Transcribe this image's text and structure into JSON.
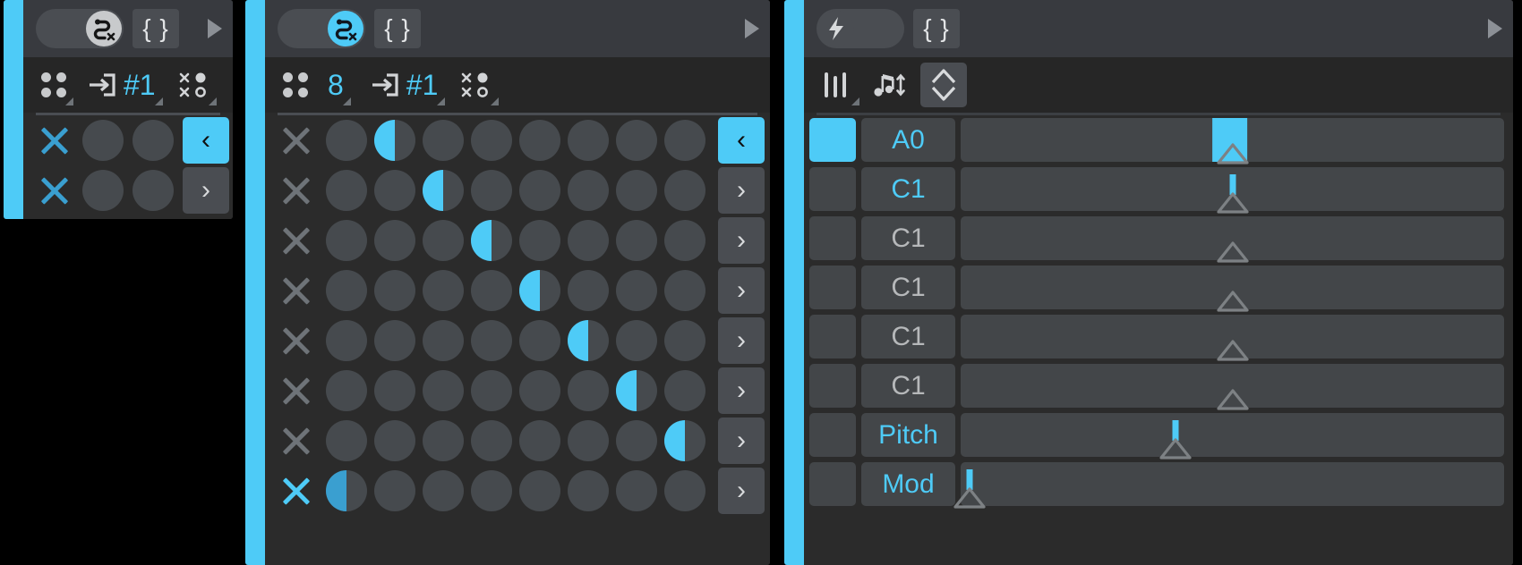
{
  "theme": {
    "accent": "#4ecbf7",
    "accent_dim": "#3a9fd0",
    "panel_bg": "#2b2b2b",
    "title_bg": "#383a3f",
    "toolbar_bg": "#262626",
    "control_bg": "#4a4d52",
    "lane_bg": "#434649",
    "text_light": "#e2e4e6",
    "text_muted": "#b6b8ba",
    "page_bg": "#000000"
  },
  "panel_modulator_small": {
    "name": "modulator-panel",
    "title": {
      "toggle_icon": "routing-disabled-icon",
      "toggle_state": "off",
      "expression_label": "{ }",
      "expand_icon": "play-triangle-icon"
    },
    "toolbar": [
      {
        "icon": "four-dots-icon",
        "label": "",
        "has_corner": true
      },
      {
        "icon": "input-arrow-icon",
        "label": "#1",
        "has_corner": true
      },
      {
        "icon": "scatter-dots-icon",
        "label": "",
        "has_corner": true
      }
    ],
    "rows": [
      {
        "clear_icon": "x-icon",
        "clear_color": "accent_dim",
        "dots": [
          0,
          0
        ],
        "nav_label": "‹",
        "nav_active": true
      },
      {
        "clear_icon": "x-icon",
        "clear_color": "accent_dim",
        "dots": [
          0,
          0
        ],
        "nav_label": "›",
        "nav_active": false
      }
    ]
  },
  "panel_sequencer": {
    "name": "step-sequencer-panel",
    "title": {
      "toggle_icon": "routing-disabled-icon",
      "toggle_state": "on",
      "expression_label": "{ }",
      "expand_icon": "play-triangle-icon"
    },
    "toolbar": [
      {
        "icon": "four-dots-icon",
        "label": "",
        "has_corner": false
      },
      {
        "icon": "",
        "label": "8",
        "has_corner": true
      },
      {
        "icon": "input-arrow-icon",
        "label": "#1",
        "has_corner": true
      },
      {
        "icon": "scatter-dots-icon",
        "label": "",
        "has_corner": true
      }
    ],
    "step_count": 8,
    "row_count": 8,
    "rows": [
      {
        "clear_icon": "x-icon",
        "clear_active": false,
        "active_step": 2,
        "step_dim": false,
        "nav_label": "‹",
        "nav_active": true
      },
      {
        "clear_icon": "x-icon",
        "clear_active": false,
        "active_step": 3,
        "step_dim": false,
        "nav_label": "›",
        "nav_active": false
      },
      {
        "clear_icon": "x-icon",
        "clear_active": false,
        "active_step": 4,
        "step_dim": false,
        "nav_label": "›",
        "nav_active": false
      },
      {
        "clear_icon": "x-icon",
        "clear_active": false,
        "active_step": 5,
        "step_dim": false,
        "nav_label": "›",
        "nav_active": false
      },
      {
        "clear_icon": "x-icon",
        "clear_active": false,
        "active_step": 6,
        "step_dim": false,
        "nav_label": "›",
        "nav_active": false
      },
      {
        "clear_icon": "x-icon",
        "clear_active": false,
        "active_step": 7,
        "step_dim": false,
        "nav_label": "›",
        "nav_active": false
      },
      {
        "clear_icon": "x-icon",
        "clear_active": false,
        "active_step": 8,
        "step_dim": false,
        "nav_label": "›",
        "nav_active": false
      },
      {
        "clear_icon": "x-icon",
        "clear_active": true,
        "active_step": 1,
        "step_dim": true,
        "nav_label": "›",
        "nav_active": false
      }
    ]
  },
  "panel_expressions": {
    "name": "note-expressions-panel",
    "title": {
      "toggle_icon": "lightning-bolt-icon",
      "toggle_state": "off",
      "expression_label": "{ }",
      "expand_icon": "play-triangle-icon"
    },
    "toolbar": [
      {
        "icon": "three-faders-icon",
        "has_corner": true
      },
      {
        "icon": "note-updown-icon",
        "has_corner": false
      },
      {
        "icon": "updown-chevrons-icon",
        "boxed": true,
        "has_corner": false
      }
    ],
    "lanes": [
      {
        "led": true,
        "label": "A0",
        "label_muted": false,
        "marker": 0.5,
        "fill": "block",
        "fill_width": 0.065,
        "fill_height": 1.0
      },
      {
        "led": false,
        "label": "C1",
        "label_muted": false,
        "marker": 0.5,
        "fill": "stem",
        "stem_height": 0.47
      },
      {
        "led": false,
        "label": "C1",
        "label_muted": true,
        "marker": 0.5,
        "fill": "none"
      },
      {
        "led": false,
        "label": "C1",
        "label_muted": true,
        "marker": 0.5,
        "fill": "none"
      },
      {
        "led": false,
        "label": "C1",
        "label_muted": true,
        "marker": 0.5,
        "fill": "none"
      },
      {
        "led": false,
        "label": "C1",
        "label_muted": true,
        "marker": 0.5,
        "fill": "none"
      },
      {
        "led": false,
        "label": "Pitch",
        "label_muted": false,
        "marker": 0.395,
        "fill": "stem",
        "stem_height": 0.47
      },
      {
        "led": false,
        "label": "Mod",
        "label_muted": false,
        "marker": 0.017,
        "fill": "stem",
        "stem_height": 0.47
      }
    ]
  }
}
